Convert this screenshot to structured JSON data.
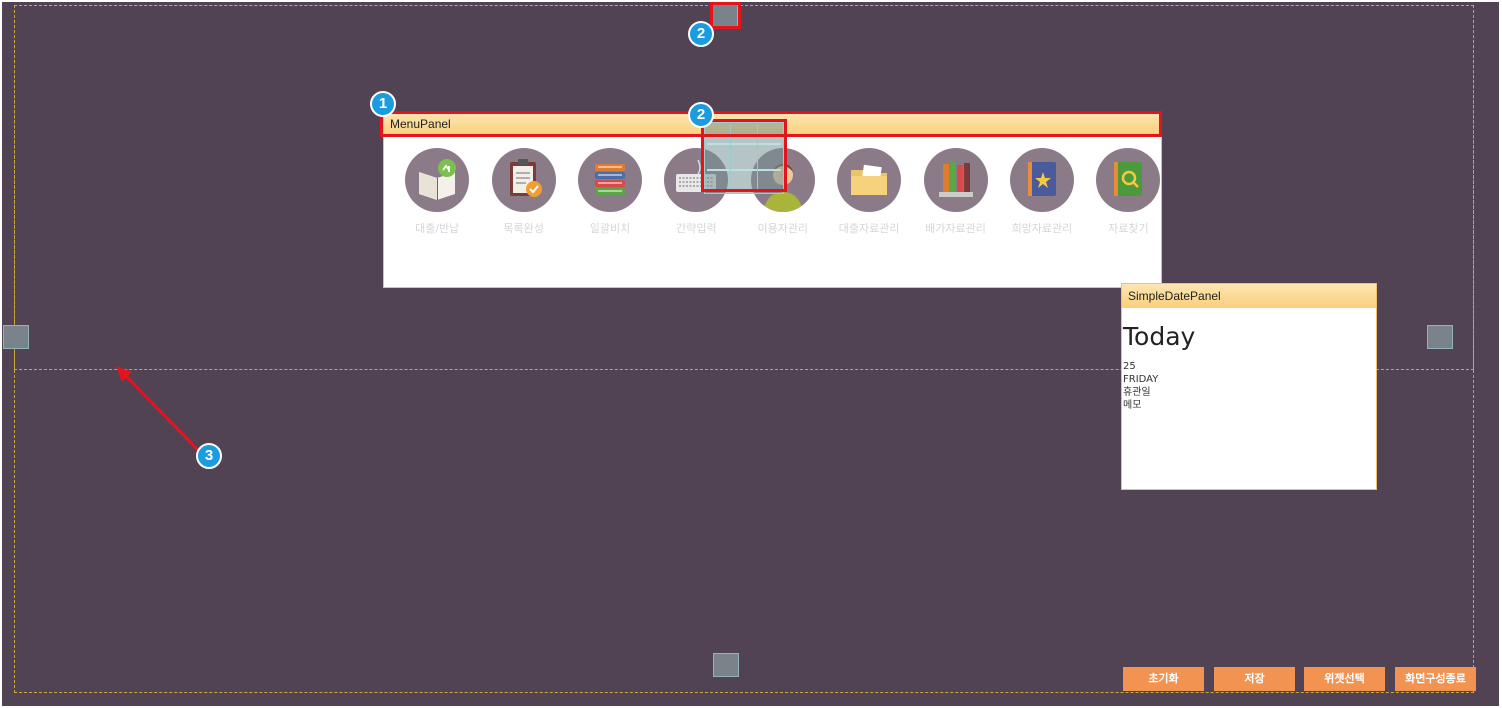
{
  "menu_panel": {
    "title": "MenuPanel",
    "items": [
      {
        "label": "대출/반납",
        "icon": "book-return-icon"
      },
      {
        "label": "목록완성",
        "icon": "clipboard-check-icon"
      },
      {
        "label": "일괄비치",
        "icon": "book-stack-icon"
      },
      {
        "label": "간략입력",
        "icon": "keyboard-icon"
      },
      {
        "label": "이용자관리",
        "icon": "user-icon"
      },
      {
        "label": "대출자료관리",
        "icon": "folder-icon"
      },
      {
        "label": "배가자료관리",
        "icon": "bookshelf-icon"
      },
      {
        "label": "희망자료관리",
        "icon": "star-book-icon"
      },
      {
        "label": "자료찾기",
        "icon": "search-book-icon"
      }
    ]
  },
  "date_panel": {
    "title": "SimpleDatePanel",
    "heading": "Today",
    "day": "25",
    "weekday": "FRIDAY",
    "status": "휴관일",
    "memo": "메모"
  },
  "markers": {
    "m1": "1",
    "m2_top": "2",
    "m2_panel": "2",
    "m3": "3"
  },
  "actions": {
    "reset": "초기화",
    "save": "저장",
    "widget_select": "위젯선택",
    "exit_layout": "화면구성종료"
  },
  "colors": {
    "workspace": "#514354",
    "panel_header": "#f9cf7c",
    "highlight": "#e3141b",
    "marker": "#1b9be0",
    "button": "#f39352"
  }
}
